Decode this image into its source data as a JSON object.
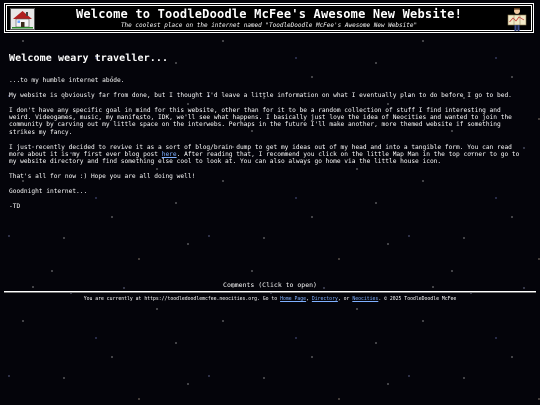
{
  "header": {
    "title": "Welcome to ToodleDoodle McFee's Awesome New Website!",
    "subtitle": "The coolest place on the internet named \"ToodleDoodle McFee's Awesome New Website\""
  },
  "main": {
    "heading": "Welcome weary traveller...",
    "intro": "...to my humble internet abode.",
    "p1": "My website is obviously far from done, but I thought I'd leave a little information on what I eventually plan to do before I go to bed.",
    "p2": "I don't have any specific goal in mind for this website, other than for it to be a random collection of stuff I find interesting and weird. Videogames, music, my manifesto, IDK, we'll see what happens. I basically just love the idea of Neocities and wanted to join the community by carving out my little space on the interwebs. Perhaps in the future I'll make another, more themed website if something strikes my fancy.",
    "p3_before_link": "I just recently decided to revive it as a sort of blog/brain dump to get my ideas out of my head and into a tangible form. You can read more about it is my first ever blog post ",
    "p3_link": "here",
    "p3_after_link": ". After reading that, I recommend you click on the little Map Man in the top corner to go to my website directory and find something else cool to look at. You can also always go home via the little house icon.",
    "p4": "That's all for now :) Hope you are all doing well!",
    "p5": "Goodnight internet...",
    "signature": "-TD"
  },
  "comments": {
    "label": "Comments (Click to open)"
  },
  "footer": {
    "prefix": "You are currently at https://toodledoodlemcfee.neocities.org. Go to ",
    "link_home": "Home Page",
    "sep1": ", ",
    "link_directory": "Directory",
    "sep2": ", or ",
    "link_neocities": "Neocities",
    "suffix": ". © 2025 ToodleDoodle McFee"
  },
  "icons": {
    "home": "house-icon",
    "map": "map-man-icon"
  },
  "colors": {
    "background": "#04040a",
    "text": "#ffffff",
    "link": "#7fb0ff"
  }
}
